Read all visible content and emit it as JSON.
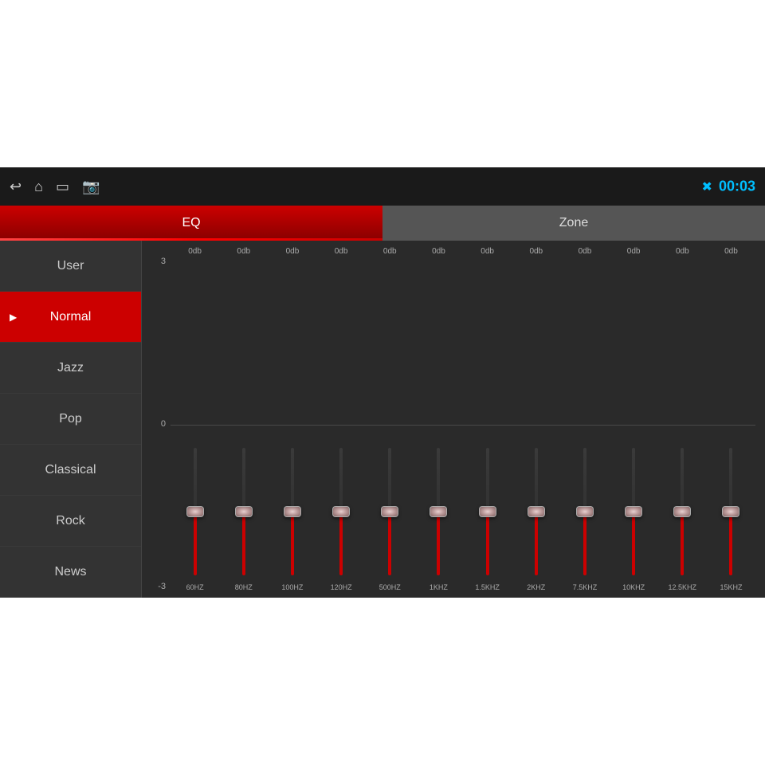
{
  "topbar": {
    "time": "00:03",
    "icons": [
      "back-icon",
      "home-icon",
      "window-icon",
      "image-icon"
    ]
  },
  "tabs": [
    {
      "label": "EQ",
      "active": true
    },
    {
      "label": "Zone",
      "active": false
    }
  ],
  "sidebar": {
    "items": [
      {
        "label": "User",
        "active": false
      },
      {
        "label": "Normal",
        "active": true
      },
      {
        "label": "Jazz",
        "active": false
      },
      {
        "label": "Pop",
        "active": false
      },
      {
        "label": "Classical",
        "active": false
      },
      {
        "label": "Rock",
        "active": false
      },
      {
        "label": "News",
        "active": false
      }
    ]
  },
  "eq": {
    "scale": [
      "3",
      "0",
      "-3"
    ],
    "bands": [
      {
        "freq": "60HZ",
        "db": "0db",
        "value": 0
      },
      {
        "freq": "80HZ",
        "db": "0db",
        "value": 0
      },
      {
        "freq": "100HZ",
        "db": "0db",
        "value": 0
      },
      {
        "freq": "120HZ",
        "db": "0db",
        "value": 0
      },
      {
        "freq": "500HZ",
        "db": "0db",
        "value": 0
      },
      {
        "freq": "1KHZ",
        "db": "0db",
        "value": 0
      },
      {
        "freq": "1.5KHZ",
        "db": "0db",
        "value": 0
      },
      {
        "freq": "2KHZ",
        "db": "0db",
        "value": 0
      },
      {
        "freq": "7.5KHZ",
        "db": "0db",
        "value": 0
      },
      {
        "freq": "10KHZ",
        "db": "0db",
        "value": 0
      },
      {
        "freq": "12.5KHZ",
        "db": "0db",
        "value": 0
      },
      {
        "freq": "15KHZ",
        "db": "0db",
        "value": 0
      }
    ]
  }
}
